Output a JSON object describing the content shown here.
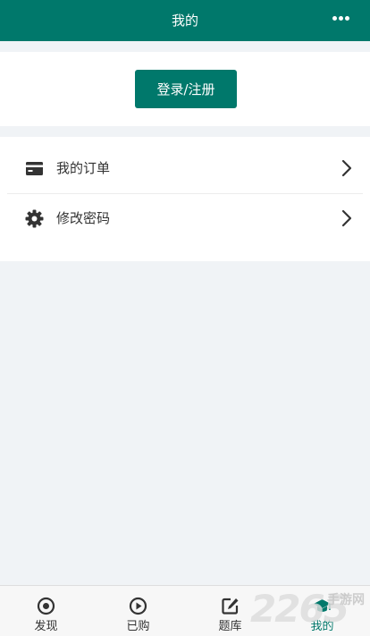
{
  "header": {
    "title": "我的",
    "more_icon": "more-dots-icon"
  },
  "login": {
    "button_label": "登录/注册"
  },
  "menu": {
    "items": [
      {
        "label": "我的订单",
        "icon": "card-icon"
      },
      {
        "label": "修改密码",
        "icon": "gear-icon"
      }
    ]
  },
  "tabbar": {
    "tabs": [
      {
        "label": "发现",
        "icon": "target-icon",
        "active": false
      },
      {
        "label": "已购",
        "icon": "play-circle-icon",
        "active": false
      },
      {
        "label": "题库",
        "icon": "edit-icon",
        "active": false
      },
      {
        "label": "我的",
        "icon": "graduation-cap-icon",
        "active": true
      }
    ]
  },
  "watermark": {
    "number": "2265",
    "text": "手游网"
  },
  "colors": {
    "brand": "#00786b",
    "background": "#f0f3f6",
    "text": "#333333"
  }
}
